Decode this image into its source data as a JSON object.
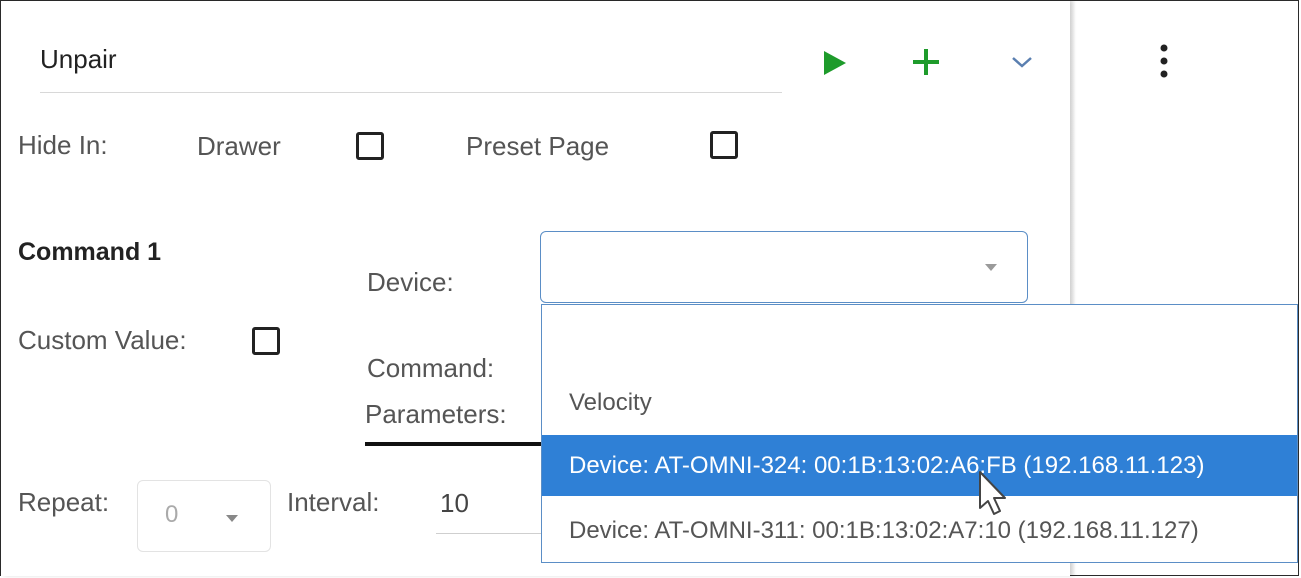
{
  "header": {
    "title": "Unpair"
  },
  "hide_in": {
    "label": "Hide In:",
    "drawer_label": "Drawer",
    "drawer_checked": false,
    "preset_label": "Preset Page",
    "preset_checked": false
  },
  "command": {
    "title": "Command 1",
    "device_label": "Device:",
    "device_value": "",
    "custom_value_label": "Custom Value:",
    "custom_value_checked": false,
    "command_label": "Command:",
    "parameters_label": "Parameters:"
  },
  "repeat": {
    "label": "Repeat:",
    "value": "0"
  },
  "interval": {
    "label": "Interval:",
    "value": "10"
  },
  "dropdown": {
    "group_label": "Velocity",
    "options": [
      {
        "label": "Device: AT-OMNI-324: 00:1B:13:02:A6:FB (192.168.11.123)",
        "selected": true
      },
      {
        "label": "Device: AT-OMNI-311: 00:1B:13:02:A7:10 (192.168.11.127)",
        "selected": false
      }
    ]
  },
  "icons": {
    "play": "play-icon",
    "add": "plus-icon",
    "collapse": "chevron-down-icon",
    "more": "more-vertical-icon"
  },
  "colors": {
    "accent_green": "#1e9b2b",
    "selected_blue": "#2f80d6",
    "focus_border": "#5b8ec6"
  }
}
